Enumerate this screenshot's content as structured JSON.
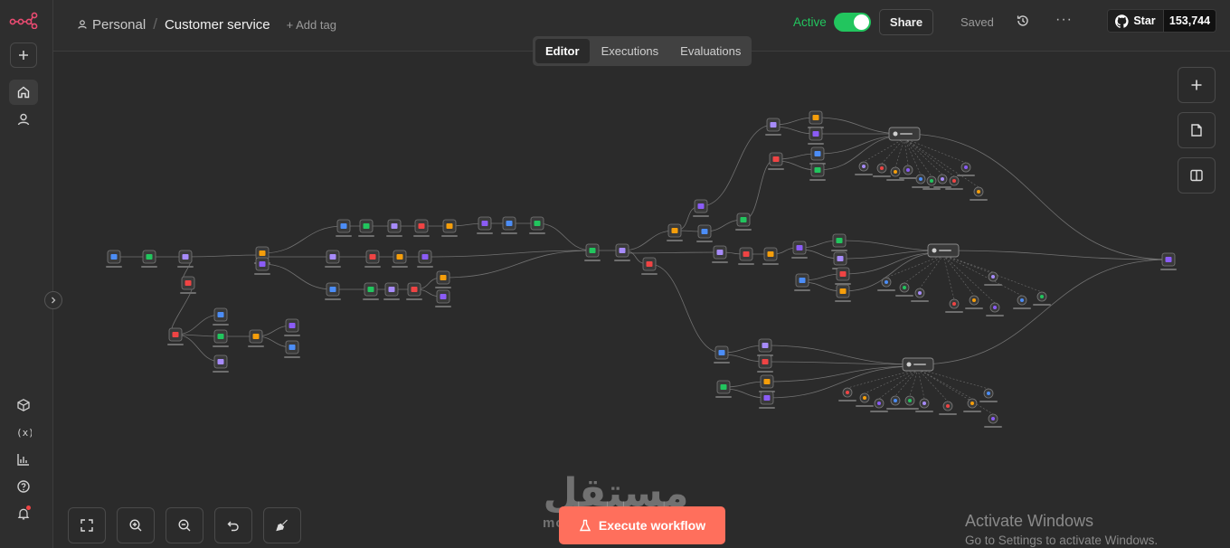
{
  "header": {
    "project": "Personal",
    "workflow_name": "Customer service",
    "add_tag": "+ Add tag",
    "active_label": "Active",
    "share_label": "Share",
    "saved_label": "Saved",
    "github_star": "Star",
    "github_count": "153,744"
  },
  "tabs": [
    {
      "label": "Editor",
      "selected": true
    },
    {
      "label": "Executions",
      "selected": false
    },
    {
      "label": "Evaluations",
      "selected": false
    }
  ],
  "execute_button": "Execute workflow",
  "watermark": {
    "logo_text": "مستقل",
    "sub_text": "mostaql.com"
  },
  "os_notice": {
    "title": "Activate Windows",
    "subtitle": "Go to Settings to activate Windows."
  },
  "colors": {
    "accent_orange": "#ff6f5c",
    "active_green": "#22c55e",
    "canvas_bg": "#2b2b2b",
    "node_bg": "#3a3a3a",
    "edge_color": "#8a8a8a"
  },
  "icons": {
    "logo": "n8n-logo-icon",
    "add": "plus-icon",
    "home": "home-icon",
    "user": "user-icon",
    "templates": "cube-icon",
    "variables": "variables-icon",
    "insights": "chart-icon",
    "help": "help-icon",
    "notifications": "bell-icon",
    "history": "history-icon",
    "github": "github-icon",
    "zoom_fit": "fit-view-icon",
    "zoom_in": "zoom-in-icon",
    "zoom_out": "zoom-out-icon",
    "undo": "undo-icon",
    "tidy": "broom-icon",
    "sticky": "sticky-note-icon",
    "panel": "panel-icon"
  }
}
